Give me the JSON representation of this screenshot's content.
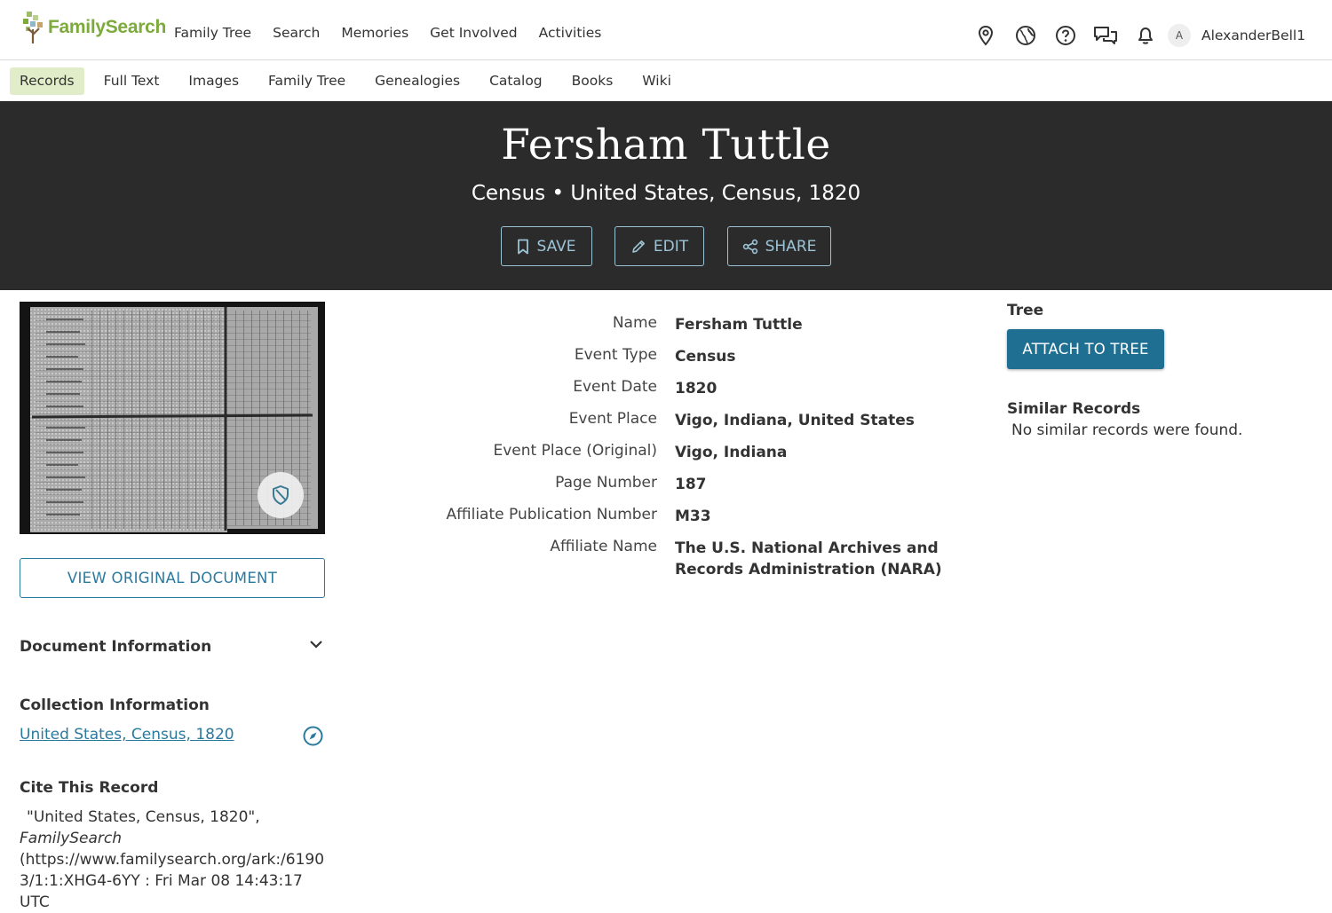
{
  "header": {
    "logo_text": "FamilySearch",
    "nav": [
      "Family Tree",
      "Search",
      "Memories",
      "Get Involved",
      "Activities"
    ],
    "icons": [
      "location-pin-icon",
      "globe-icon",
      "help-icon",
      "chat-icon",
      "bell-icon"
    ],
    "avatar_initial": "A",
    "username": "AlexanderBell1"
  },
  "subnav": {
    "items": [
      "Records",
      "Full Text",
      "Images",
      "Family Tree",
      "Genealogies",
      "Catalog",
      "Books",
      "Wiki"
    ],
    "active": "Records"
  },
  "banner": {
    "title": "Fersham Tuttle",
    "subtitle": "Census • United States, Census, 1820",
    "buttons": {
      "save": "SAVE",
      "edit": "EDIT",
      "share": "SHARE"
    }
  },
  "left": {
    "view_button": "VIEW ORIGINAL DOCUMENT",
    "document_info_title": "Document Information",
    "collection_info_title": "Collection Information",
    "collection_link": "United States, Census, 1820",
    "cite_title": "Cite This Record",
    "cite_line1": "\"United States, Census, 1820\",",
    "cite_line2": "FamilySearch",
    "cite_line3": "(https://www.familysearch.org/ark:/6190",
    "cite_line4": "3/1:1:XHG4-6YY : Fri Mar 08 14:43:17 UTC"
  },
  "record": {
    "fields": [
      {
        "label": "Name",
        "value": "Fersham Tuttle"
      },
      {
        "label": "Event Type",
        "value": "Census"
      },
      {
        "label": "Event Date",
        "value": "1820"
      },
      {
        "label": "Event Place",
        "value": "Vigo, Indiana, United States"
      },
      {
        "label": "Event Place (Original)",
        "value": "Vigo, Indiana"
      },
      {
        "label": "Page Number",
        "value": "187"
      },
      {
        "label": "Affiliate Publication Number",
        "value": "M33"
      },
      {
        "label": "Affiliate Name",
        "value": "The U.S. National Archives and Records Administration (NARA)"
      }
    ]
  },
  "right": {
    "tree_label": "Tree",
    "attach_button": "ATTACH TO TREE",
    "similar_title": "Similar Records",
    "similar_text": "No similar records were found."
  },
  "colors": {
    "brand_green": "#7cab3c",
    "banner_bg": "#2b2b2b",
    "link_blue": "#2b7a9e",
    "button_blue": "#1f6f93",
    "active_tab_bg": "#e1edc9"
  }
}
